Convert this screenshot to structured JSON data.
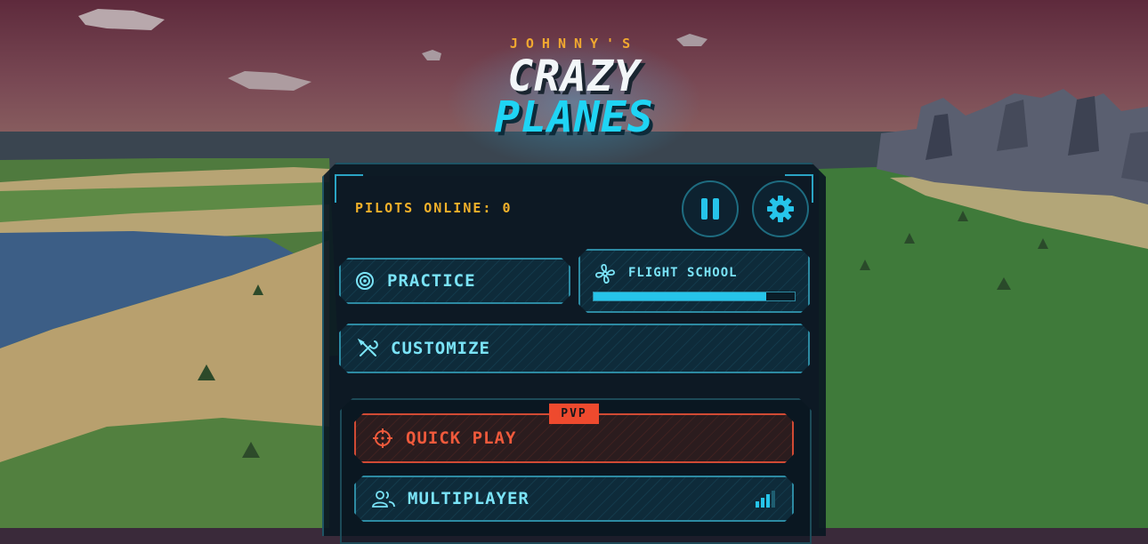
{
  "title": {
    "small": "JOHNNY'S",
    "line1": "CRAZY",
    "line2": "PLANES"
  },
  "status": {
    "pilots_online": "PILOTS ONLINE: 0"
  },
  "menu": {
    "practice": "PRACTICE",
    "flight_school": "FLIGHT SCHOOL",
    "flight_school_progress": 0.86,
    "customize": "CUSTOMIZE",
    "pvp_badge": "PVP",
    "quick_play": "QUICK PLAY",
    "multiplayer": "MULTIPLAYER"
  },
  "icons": {
    "pause": "pause-icon",
    "settings": "gear-icon",
    "practice": "target-icon",
    "flight_school": "propeller-icon",
    "customize": "tools-icon",
    "quick_play": "crosshair-icon",
    "multiplayer": "users-icon",
    "signal": "signal-bars-icon"
  },
  "colors": {
    "accent_cyan": "#26c4ea",
    "accent_orange": "#f3b12a",
    "accent_red": "#ee4a2e"
  }
}
